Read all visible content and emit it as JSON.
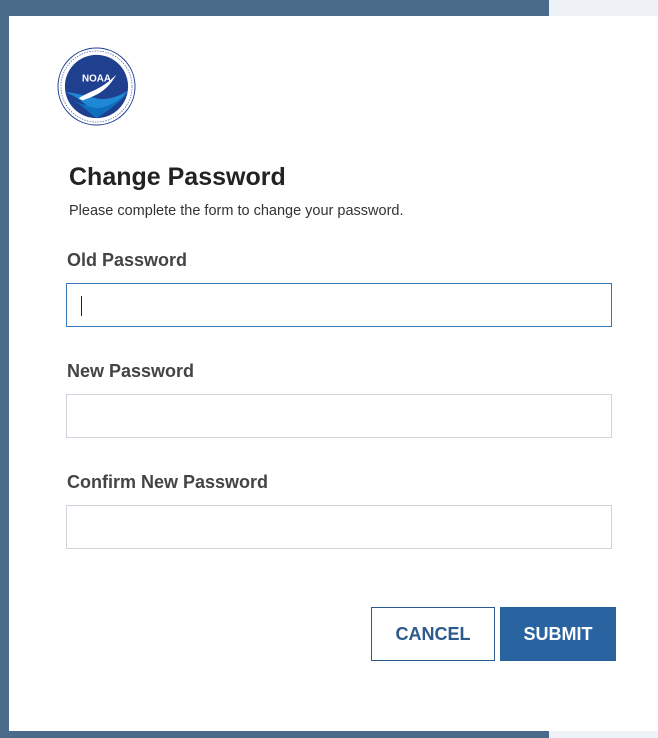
{
  "logo": {
    "icon": "noaa-logo-icon",
    "text": "NOAA"
  },
  "form": {
    "title": "Change Password",
    "subtitle": "Please complete the form to change your password.",
    "old_password": {
      "label": "Old Password",
      "value": "",
      "placeholder": ""
    },
    "new_password": {
      "label": "New Password",
      "value": "",
      "placeholder": ""
    },
    "confirm_password": {
      "label": "Confirm New Password",
      "value": "",
      "placeholder": ""
    }
  },
  "buttons": {
    "cancel": "CANCEL",
    "submit": "SUBMIT"
  },
  "colors": {
    "frame": "#4a6b8a",
    "primary": "#2a64a0",
    "focus_border": "#3a77b5"
  }
}
